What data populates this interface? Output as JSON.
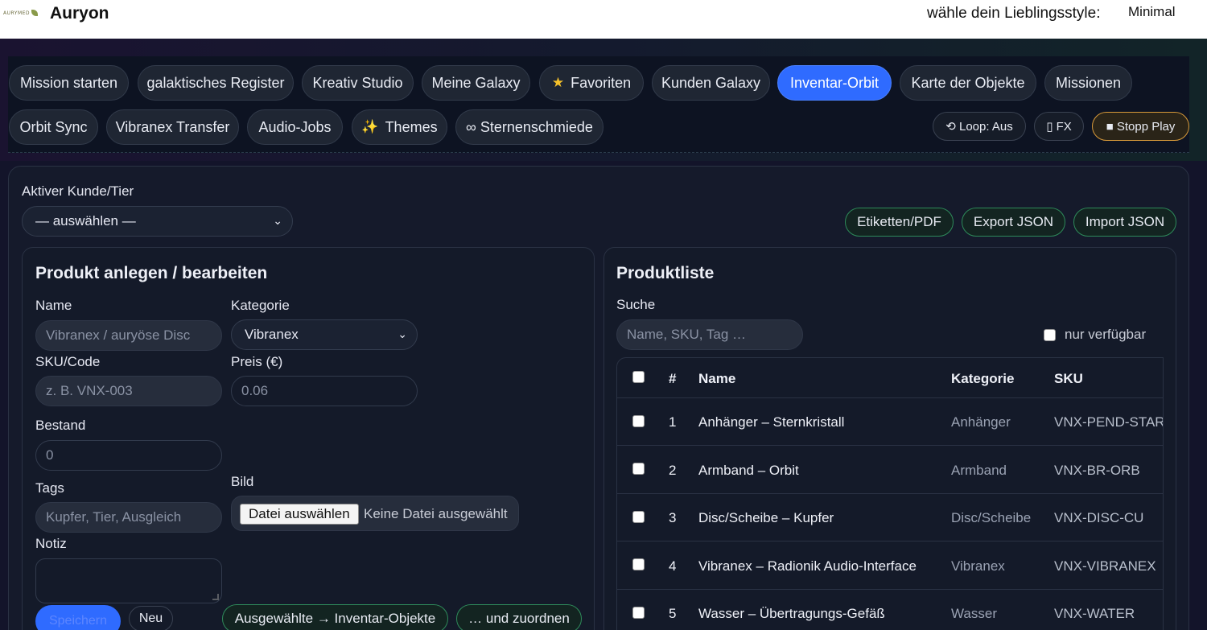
{
  "header": {
    "logo_text": "AURYMED",
    "brand": "Auryon",
    "style_label": "wähle dein Lieblingsstyle:",
    "style_value": "Minimal"
  },
  "nav": {
    "row1": [
      {
        "label": "Mission starten"
      },
      {
        "label": "galaktisches Register"
      },
      {
        "label": "Kreativ Studio"
      },
      {
        "label": "Meine Galaxy"
      },
      {
        "label": "Favoriten",
        "icon": "★"
      },
      {
        "label": "Kunden Galaxy"
      },
      {
        "label": "Inventar-Orbit",
        "active": true
      },
      {
        "label": "Karte der Objekte"
      },
      {
        "label": "Missionen"
      }
    ],
    "row2": [
      {
        "label": "Orbit Sync"
      },
      {
        "label": "Vibranex Transfer"
      },
      {
        "label": "Audio-Jobs"
      },
      {
        "label": "Themes",
        "icon": "✨"
      },
      {
        "label": "∞ Sternenschmiede"
      }
    ],
    "controls": {
      "loop": "⟲ Loop: Aus",
      "fx": "▯ FX",
      "stop": "■ Stopp Play"
    }
  },
  "customer": {
    "label": "Aktiver Kunde/Tier",
    "select_value": "— auswählen —"
  },
  "actions": {
    "labels_pdf": "Etiketten/PDF",
    "export_json": "Export JSON",
    "import_json": "Import JSON"
  },
  "form": {
    "title": "Produkt anlegen / bearbeiten",
    "name_label": "Name",
    "name_placeholder": "Vibranex / auryöse Disc",
    "category_label": "Kategorie",
    "category_value": "Vibranex",
    "sku_label": "SKU/Code",
    "sku_placeholder": "z. B. VNX-003",
    "price_label": "Preis (€)",
    "price_placeholder": "0.06",
    "stock_label": "Bestand",
    "stock_placeholder": "0",
    "tags_label": "Tags",
    "tags_placeholder": "Kupfer, Tier, Ausgleich",
    "image_label": "Bild",
    "file_button": "Datei auswählen",
    "file_status": "Keine Datei ausgewählt",
    "note_label": "Notiz",
    "save_button": "Speichern",
    "new_button": "Neu",
    "to_inventory_button": "Ausgewählte → Inventar-Objekte",
    "assign_button": "… und zuordnen"
  },
  "list": {
    "title": "Produktliste",
    "search_label": "Suche",
    "search_placeholder": "Name, SKU, Tag …",
    "available_only": "nur verfügbar",
    "columns": [
      "#",
      "Name",
      "Kategorie",
      "SKU"
    ],
    "rows": [
      {
        "n": "1",
        "name": "Anhänger – Sternkristall",
        "category": "Anhänger",
        "sku": "VNX-PEND-STAR"
      },
      {
        "n": "2",
        "name": "Armband – Orbit",
        "category": "Armband",
        "sku": "VNX-BR-ORB"
      },
      {
        "n": "3",
        "name": "Disc/Scheibe – Kupfer",
        "category": "Disc/Scheibe",
        "sku": "VNX-DISC-CU"
      },
      {
        "n": "4",
        "name": "Vibranex – Radionik Audio-Interface",
        "category": "Vibranex",
        "sku": "VNX-VIBRANEX"
      },
      {
        "n": "5",
        "name": "Wasser – Übertragungs-Gefäß",
        "category": "Wasser",
        "sku": "VNX-WATER"
      }
    ]
  }
}
